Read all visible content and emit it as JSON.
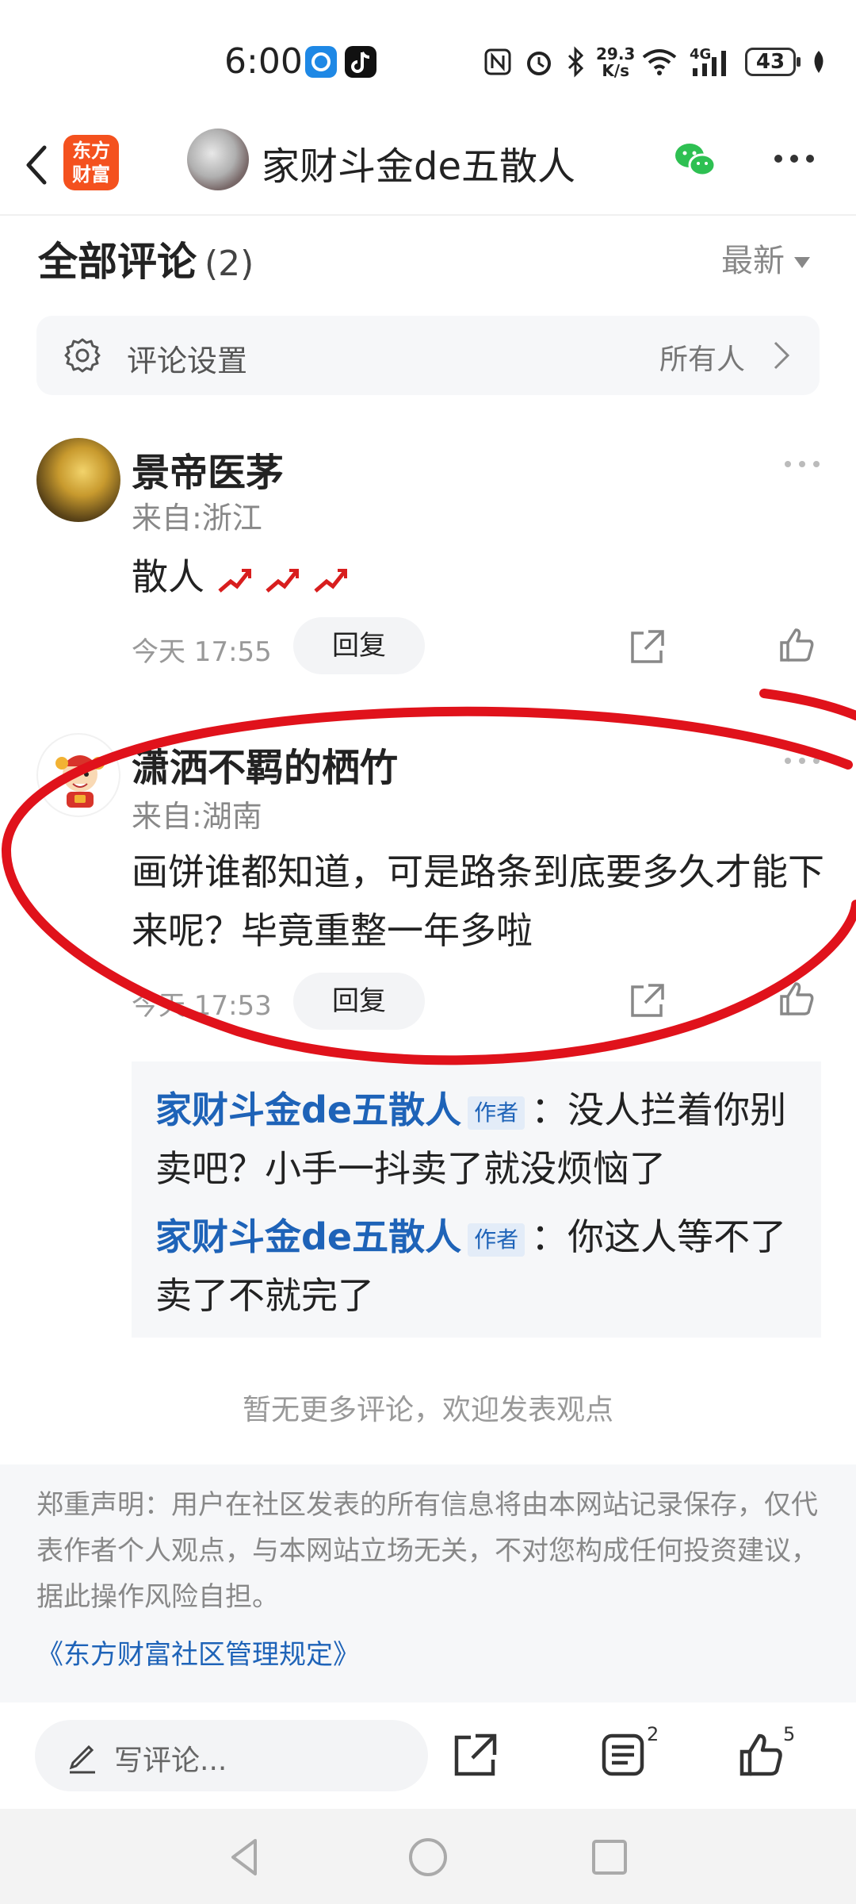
{
  "status_bar": {
    "time": "6:00",
    "net_speed_top": "29.3",
    "net_speed_bottom": "K/s",
    "network_label": "4G",
    "battery": "43"
  },
  "header": {
    "logo_text_line1": "东方",
    "logo_text_line2": "财富",
    "title": "家财斗金de五散人"
  },
  "comments_section": {
    "title": "全部评论",
    "count": "(2)",
    "sort_label": "最新",
    "settings_label": "评论设置",
    "settings_value": "所有人"
  },
  "comments": [
    {
      "username": "景帝医茅",
      "location": "来自:浙江",
      "text": "散人",
      "timestamp": "今天 17:55",
      "reply_label": "回复"
    },
    {
      "username": "潇洒不羁的栖竹",
      "location": "来自:湖南",
      "text": "画饼谁都知道，可是路条到底要多久才能下来呢？毕竟重整一年多啦",
      "timestamp": "今天 17:53",
      "reply_label": "回复",
      "replies": [
        {
          "author": "家财斗金de五散人",
          "tag": "作者",
          "text": "：没人拦着你别卖吧？小手一抖卖了就没烦恼了"
        },
        {
          "author": "家财斗金de五散人",
          "tag": "作者",
          "text": "：你这人等不了卖了不就完了"
        }
      ]
    }
  ],
  "footer": {
    "no_more": "暂无更多评论，欢迎发表观点",
    "disclaimer": "郑重声明：用户在社区发表的所有信息将由本网站记录保存，仅代表作者个人观点，与本网站立场无关，不对您构成任何投资建议，据此操作风险自担。",
    "rules_link": "《东方财富社区管理规定》"
  },
  "bottom_bar": {
    "comment_placeholder": "写评论...",
    "comments_badge": "2",
    "likes_badge": "5"
  },
  "colors": {
    "link_blue": "#1e63b8",
    "logo_orange": "#f4511e",
    "annotation_red": "#e0121b",
    "trend_red": "#d81e1e"
  }
}
